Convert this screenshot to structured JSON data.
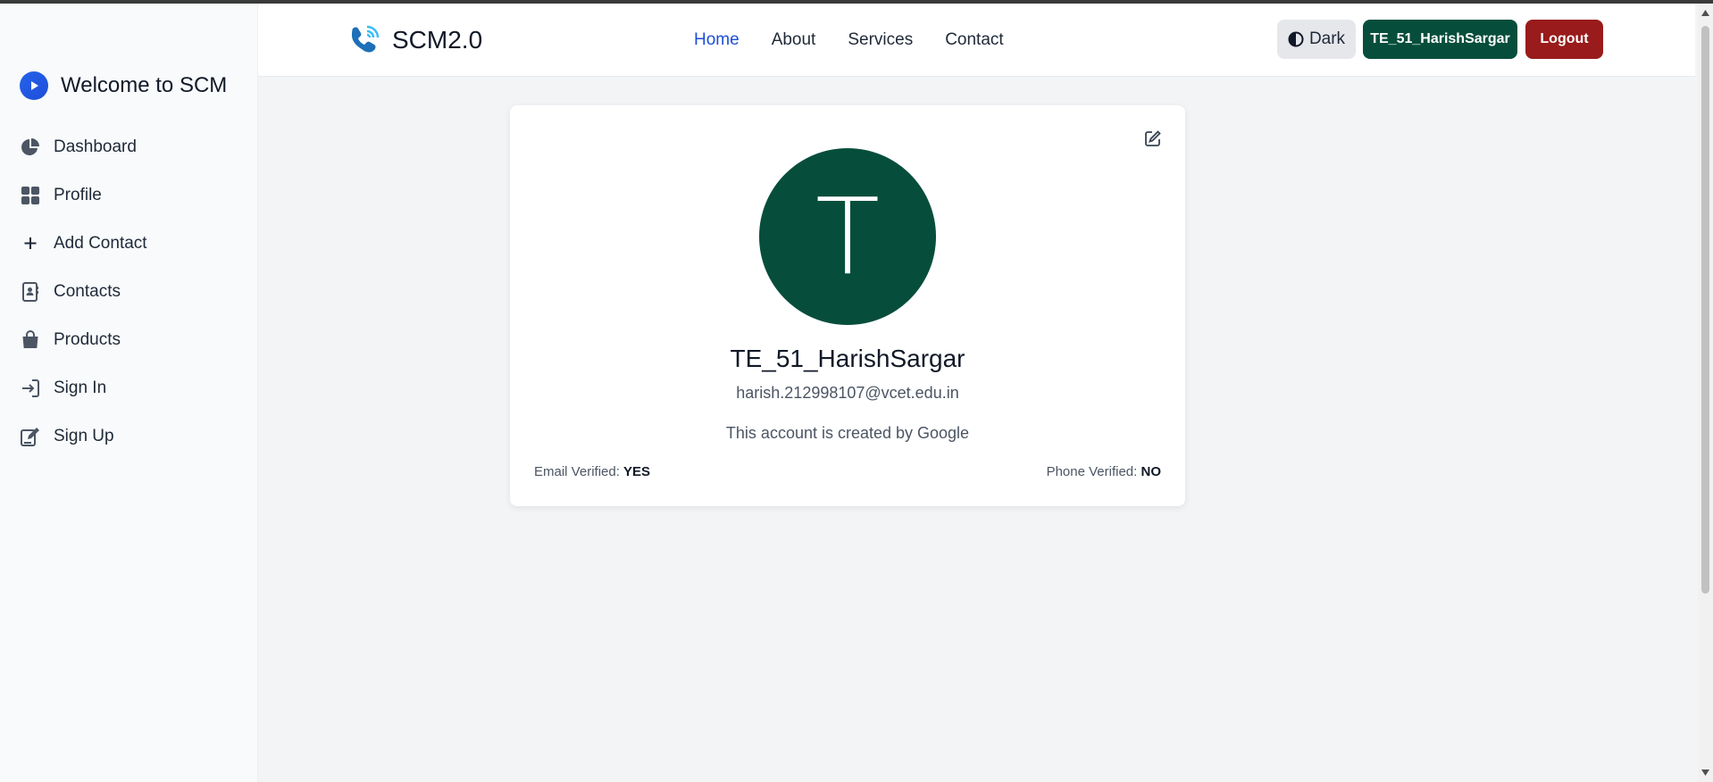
{
  "sidebar": {
    "brand_title": "Welcome to SCM",
    "items": [
      {
        "label": "Dashboard",
        "icon": "chart-pie-icon"
      },
      {
        "label": "Profile",
        "icon": "grid-icon"
      },
      {
        "label": "Add Contact",
        "icon": "plus-icon"
      },
      {
        "label": "Contacts",
        "icon": "address-book-icon"
      },
      {
        "label": "Products",
        "icon": "shopping-bag-icon"
      },
      {
        "label": "Sign In",
        "icon": "sign-in-icon"
      },
      {
        "label": "Sign Up",
        "icon": "edit-signup-icon"
      }
    ]
  },
  "header": {
    "logo_text": "SCM2.0",
    "nav": [
      {
        "label": "Home",
        "active": true
      },
      {
        "label": "About"
      },
      {
        "label": "Services"
      },
      {
        "label": "Contact"
      }
    ],
    "theme_button": "Dark",
    "user_button": "TE_51_HarishSargar",
    "logout_button": "Logout"
  },
  "profile": {
    "avatar_letter": "T",
    "name": "TE_51_HarishSargar",
    "email": "harish.212998107@vcet.edu.in",
    "note": "This account is created by Google",
    "email_verified_label": "Email Verified:",
    "email_verified_value": "YES",
    "phone_verified_label": "Phone Verified:",
    "phone_verified_value": "NO"
  },
  "colors": {
    "accent_green": "#064e3b",
    "logout_red": "#991b1b",
    "active_link": "#1d4ed8"
  }
}
